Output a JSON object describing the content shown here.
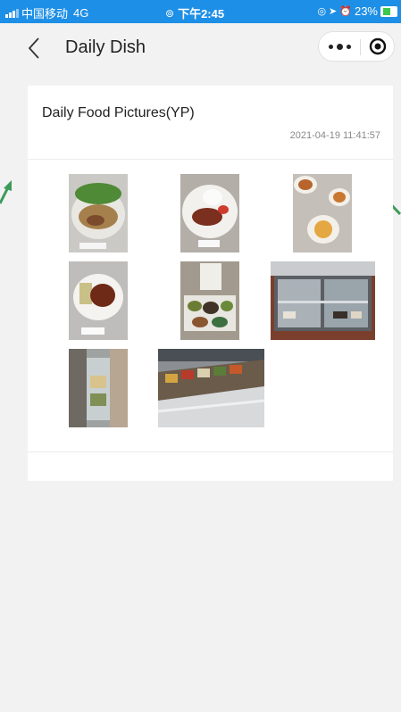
{
  "status_bar": {
    "carrier": "中国移动",
    "network": "4G",
    "time": "下午2:45",
    "battery": "23%"
  },
  "nav": {
    "title": "Daily Dish"
  },
  "card": {
    "title": "Daily Food Pictures(YP)",
    "date": "2021-04-19 11:41:57"
  },
  "photos": [
    {
      "name": "noodle-bowl-photo"
    },
    {
      "name": "rice-plate-photo"
    },
    {
      "name": "multiple-plates-photo"
    },
    {
      "name": "meat-plate-photo"
    },
    {
      "name": "lunch-tray-photo"
    },
    {
      "name": "display-case-photo"
    },
    {
      "name": "cafeteria-line-photo"
    },
    {
      "name": "buffet-counter-photo"
    }
  ],
  "colors": {
    "status_bar": "#1e8fe6",
    "arrow": "#3d9a5a"
  }
}
